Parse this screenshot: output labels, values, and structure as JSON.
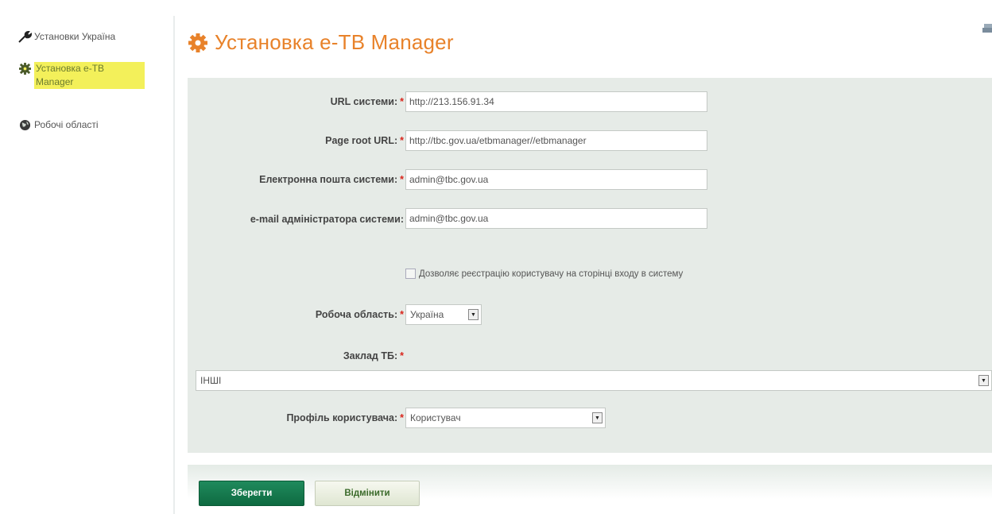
{
  "sidebar": {
    "items": [
      {
        "label": "Установки Україна",
        "icon": "wrench-icon"
      },
      {
        "label": "Установка e-TB Manager",
        "icon": "gear-icon",
        "active": true
      },
      {
        "label": "Робочі області",
        "icon": "globe-icon"
      }
    ]
  },
  "header": {
    "title": "Установка e-TB Manager",
    "icon": "gear-icon",
    "accent": "#e8822a"
  },
  "form": {
    "url_label": "URL системи:",
    "url_value": "http://213.156.91.34",
    "root_label": "Page root URL:",
    "root_value": "http://tbc.gov.ua/etbmanager//etbmanager",
    "email_label": "Електронна пошта системи:",
    "email_value": "admin@tbc.gov.ua",
    "admin_email_label": "e-mail адміністратора системи:",
    "admin_email_value": "admin@tbc.gov.ua",
    "allow_register_label": "Дозволяє реєстрацію користувачу на сторінці входу в систему",
    "allow_register_checked": false,
    "workspace_label": "Робоча область:",
    "workspace_value": "Україна",
    "facility_label": "Заклад ТБ:",
    "facility_value": "ІНШІ",
    "profile_label": "Профіль користувача:",
    "profile_value": "Користувач",
    "required_mark": "*"
  },
  "actions": {
    "save_label": "Зберегти",
    "cancel_label": "Відмінити"
  }
}
